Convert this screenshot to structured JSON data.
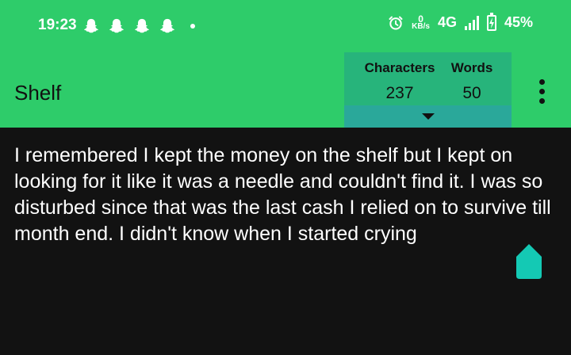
{
  "status_bar": {
    "time": "19:23",
    "notification_icons": [
      "snapchat-icon",
      "snapchat-icon",
      "snapchat-icon",
      "snapchat-icon"
    ],
    "alarm_icon": "alarm-icon",
    "data_speed_value": "0",
    "data_speed_unit": "KB/s",
    "network": "4G",
    "battery_percent": "45%"
  },
  "app_bar": {
    "title": "Shelf",
    "counter": {
      "characters_label": "Characters",
      "characters_value": "237",
      "words_label": "Words",
      "words_value": "50"
    },
    "menu_icon": "more-vert-icon"
  },
  "editor": {
    "text": "I remembered I kept the money on the shelf but I kept on looking for it like it was a needle and couldn't find it. I was so disturbed since that was the last cash I relied on to survive till month end. I didn't know when I started crying"
  },
  "colors": {
    "app_bar": "#2ecc6a",
    "counter_bg": "#27b47b",
    "expand_bg": "#2aa89a",
    "editor_bg": "#121212",
    "accent_fab": "#14c9b4"
  }
}
